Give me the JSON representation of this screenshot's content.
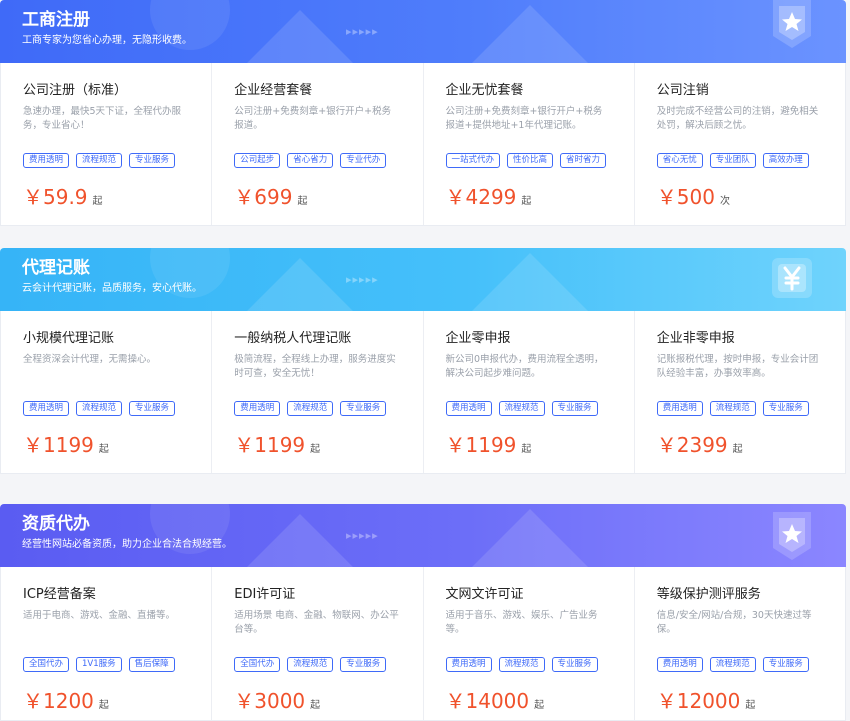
{
  "colors": {
    "accent": "#3f6af8",
    "price": "#f0522c"
  },
  "sections": [
    {
      "title": "工商注册",
      "subtitle": "工商专家为您省心办理，无隐形收费。",
      "badge_icon": "star-shield-icon",
      "cards": [
        {
          "title": "公司注册（标准）",
          "desc": "急速办理，最快5天下证，全程代办服务，专业省心！",
          "tags": [
            "费用透明",
            "流程规范",
            "专业服务"
          ],
          "price": "￥59.9",
          "unit": "起"
        },
        {
          "title": "企业经营套餐",
          "desc": "公司注册+免费刻章+银行开户+税务报道。",
          "tags": [
            "公司起步",
            "省心省力",
            "专业代办"
          ],
          "price": "￥699",
          "unit": "起"
        },
        {
          "title": "企业无忧套餐",
          "desc": "公司注册+免费刻章+银行开户+税务报道+提供地址+1年代理记账。",
          "tags": [
            "一站式代办",
            "性价比高",
            "省时省力"
          ],
          "price": "￥4299",
          "unit": "起"
        },
        {
          "title": "公司注销",
          "desc": "及时完成不经营公司的注销，避免相关处罚，解决后顾之忧。",
          "tags": [
            "省心无忧",
            "专业团队",
            "高效办理"
          ],
          "price": "￥500",
          "unit": "次"
        }
      ]
    },
    {
      "title": "代理记账",
      "subtitle": "云会计代理记账，品质服务，安心代账。",
      "badge_icon": "yuan-icon",
      "cards": [
        {
          "title": "小规模代理记账",
          "desc": "全程资深会计代理，无需操心。",
          "tags": [
            "费用透明",
            "流程规范",
            "专业服务"
          ],
          "price": "￥1199",
          "unit": "起"
        },
        {
          "title": "一般纳税人代理记账",
          "desc": "极简流程，全程线上办理，服务进度实时可查，安全无忧！",
          "tags": [
            "费用透明",
            "流程规范",
            "专业服务"
          ],
          "price": "￥1199",
          "unit": "起"
        },
        {
          "title": "企业零申报",
          "desc": "新公司0申报代办，费用流程全透明，解决公司起步难问题。",
          "tags": [
            "费用透明",
            "流程规范",
            "专业服务"
          ],
          "price": "￥1199",
          "unit": "起"
        },
        {
          "title": "企业非零申报",
          "desc": "记账报税代理，按时申报，专业会计团队经验丰富，办事效率高。",
          "tags": [
            "费用透明",
            "流程规范",
            "专业服务"
          ],
          "price": "￥2399",
          "unit": "起"
        }
      ]
    },
    {
      "title": "资质代办",
      "subtitle": "经营性网站必备资质，助力企业合法合规经营。",
      "badge_icon": "star-shield-icon",
      "cards": [
        {
          "title": "ICP经营备案",
          "desc": "适用于电商、游戏、金融、直播等。",
          "tags": [
            "全国代办",
            "1V1服务",
            "售后保障"
          ],
          "price": "￥1200",
          "unit": "起"
        },
        {
          "title": "EDI许可证",
          "desc": "适用场景 电商、金融、物联网、办公平台等。",
          "tags": [
            "全国代办",
            "流程规范",
            "专业服务"
          ],
          "price": "￥3000",
          "unit": "起"
        },
        {
          "title": "文网文许可证",
          "desc": "适用于音乐、游戏、娱乐、广告业务等。",
          "tags": [
            "费用透明",
            "流程规范",
            "专业服务"
          ],
          "price": "￥14000",
          "unit": "起"
        },
        {
          "title": "等级保护测评服务",
          "desc": "信息/安全/网站/合规，30天快速过等保。",
          "tags": [
            "费用透明",
            "流程规范",
            "专业服务"
          ],
          "price": "￥12000",
          "unit": "起"
        }
      ]
    }
  ]
}
